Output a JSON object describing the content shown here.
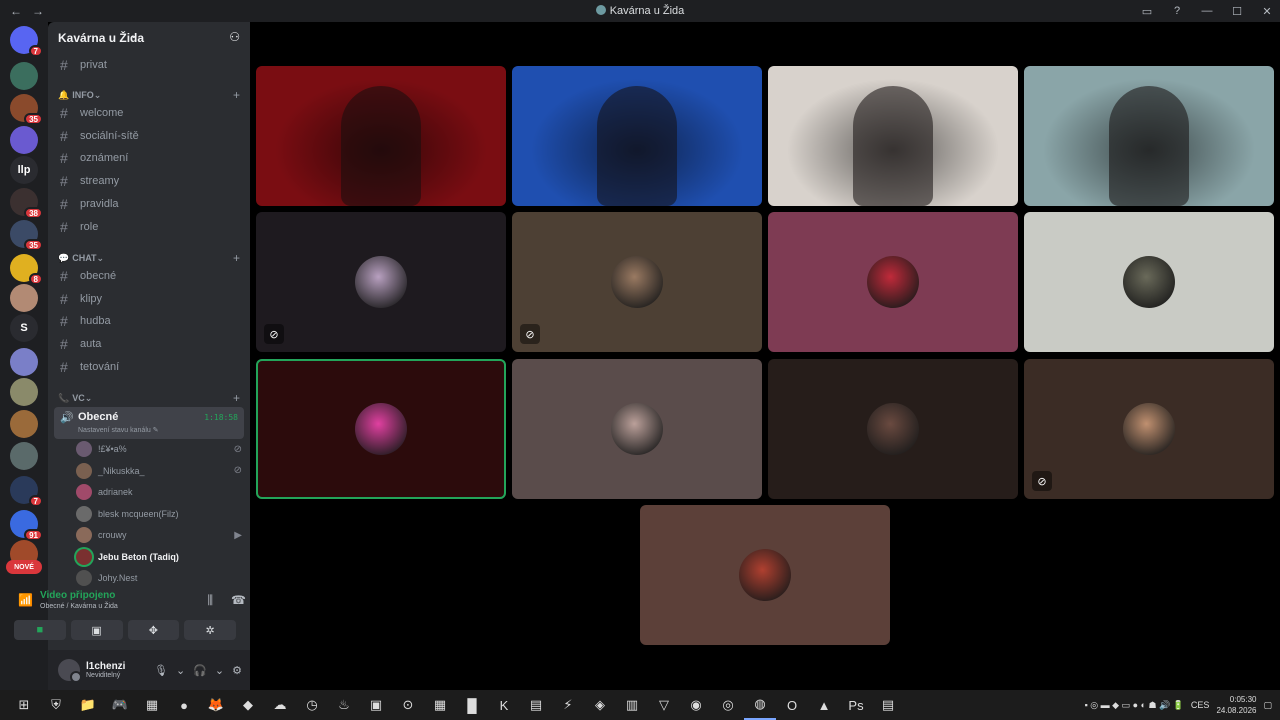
{
  "window": {
    "title": "Kavárna u Žida",
    "nav_back": "←",
    "nav_forward": "→",
    "controls": [
      "inbox-icon",
      "help-icon",
      "minimize",
      "maximize",
      "close"
    ]
  },
  "server_rail": {
    "servers": [
      {
        "label": "",
        "badge": "7",
        "color": "#5865f2",
        "icon": "discord-icon"
      },
      {
        "label": "",
        "badge": "",
        "color": "#3b6e5e"
      },
      {
        "label": "",
        "badge": "35",
        "color": "#8a4a2c"
      },
      {
        "label": "",
        "badge": "",
        "color": "#6a5ad0"
      },
      {
        "label": "llp",
        "badge": "",
        "color": "#2a2b30"
      },
      {
        "label": "",
        "badge": "38",
        "color": "#3b3030"
      },
      {
        "label": "",
        "badge": "35",
        "color": "#3b4a66"
      },
      {
        "label": "",
        "badge": "8",
        "color": "#e0b020"
      },
      {
        "label": "",
        "badge": "",
        "color": "#b28a74"
      },
      {
        "label": "S",
        "badge": "",
        "color": "#2a2b30"
      },
      {
        "label": "",
        "badge": "",
        "color": "#7a7fc8"
      },
      {
        "label": "",
        "badge": "",
        "color": "#8a8a6a"
      },
      {
        "label": "",
        "badge": "",
        "color": "#9a6a3a"
      },
      {
        "label": "",
        "badge": "",
        "color": "#5a6a6a"
      },
      {
        "label": "",
        "badge": "7",
        "color": "#2a3a5a"
      },
      {
        "label": "",
        "badge": "91",
        "color": "#3a6ae0"
      },
      {
        "label": "",
        "badge": "",
        "color": "#a04a2a"
      }
    ],
    "new_label": "NOVÉ"
  },
  "guild": {
    "name": "Kavárna u Žida",
    "top_channel": "privat",
    "categories": [
      {
        "name": "INFO",
        "emoji": "🔔",
        "channels": [
          "welcome",
          "sociální-sítě",
          "oznámení",
          "streamy",
          "pravidla",
          "role"
        ]
      },
      {
        "name": "CHAT",
        "emoji": "💬",
        "channels": [
          "obecné",
          "klipy",
          "hudba",
          "auta",
          "tetování"
        ]
      },
      {
        "name": "VC",
        "emoji": "📞",
        "channels": []
      }
    ],
    "active_voice": {
      "name": "Obecné",
      "timer": "1:18:58",
      "status": "Nastavení stavu kanálu"
    },
    "members": [
      {
        "name": "!£¥•a%",
        "trail": "⊘",
        "speaking": false,
        "color": "#6a5a70"
      },
      {
        "name": "_Nikuskka_",
        "trail": "⊘",
        "speaking": false,
        "color": "#7a6050"
      },
      {
        "name": "adrianek",
        "trail": "",
        "speaking": false,
        "color": "#a04a6a"
      },
      {
        "name": "blesk mcqueen(Filz)",
        "trail": "",
        "speaking": false,
        "color": "#6a6a6a"
      },
      {
        "name": "crouwy",
        "trail": "▶",
        "speaking": false,
        "color": "#8a6a5a"
      },
      {
        "name": "Jebu Beton (Tadiq)",
        "trail": "",
        "speaking": true,
        "color": "#7a3030"
      },
      {
        "name": "Johy.Nest",
        "trail": "",
        "speaking": false,
        "color": "#505050"
      }
    ]
  },
  "voice_panel": {
    "status": "Video připojeno",
    "location": "Obecné / Kavárna u Žida",
    "buttons": [
      "camera-icon",
      "screen-share-icon",
      "activities-icon",
      "soundboard-icon"
    ]
  },
  "user": {
    "name": "l1chenzi",
    "status": "Neviditelný"
  },
  "video_tiles": [
    {
      "kind": "camera",
      "bg": "#7a0d12",
      "muted": false,
      "speaking": false
    },
    {
      "kind": "camera",
      "bg": "#1f4fb0",
      "muted": false,
      "speaking": false
    },
    {
      "kind": "camera",
      "bg": "#d8d2cc",
      "muted": false,
      "speaking": false
    },
    {
      "kind": "camera",
      "bg": "#8aa5a8",
      "muted": false,
      "speaking": false
    },
    {
      "kind": "avatar",
      "bg": "#1e1a1f",
      "av": "#b8a0c0",
      "muted": true,
      "speaking": false
    },
    {
      "kind": "avatar",
      "bg": "#4d4034",
      "av": "#9a7a62",
      "muted": true,
      "speaking": false
    },
    {
      "kind": "avatar",
      "bg": "#7e3b53",
      "av": "#c02a3a",
      "muted": false,
      "speaking": false
    },
    {
      "kind": "avatar",
      "bg": "#c9cbc5",
      "av": "#6a6a5a",
      "muted": false,
      "speaking": false
    },
    {
      "kind": "avatar",
      "bg": "#2c0b0c",
      "av": "#e040a0",
      "muted": false,
      "speaking": true
    },
    {
      "kind": "avatar",
      "bg": "#5a4c4b",
      "av": "#bba09a",
      "muted": false,
      "speaking": false
    },
    {
      "kind": "avatar",
      "bg": "#261d1a",
      "av": "#6a4a40",
      "muted": false,
      "speaking": false
    },
    {
      "kind": "avatar",
      "bg": "#3b2c25",
      "av": "#c09070",
      "muted": true,
      "speaking": false
    },
    {
      "kind": "avatar",
      "bg": "#5c4039",
      "av": "#b04030",
      "muted": false,
      "speaking": false
    }
  ],
  "taskbar": {
    "apps": [
      "⊞",
      "⛨",
      "📁",
      "🎮",
      "▦",
      "●",
      "🦊",
      "◆",
      "☁",
      "◷",
      "♨",
      "▣",
      "⊙",
      "▦",
      "█",
      "K",
      "▤",
      "⚡",
      "◈",
      "▥",
      "▽",
      "◉",
      "◎",
      "◍",
      "O",
      "▲",
      "Ps",
      "▤"
    ],
    "tray_lang": "CES",
    "time": "0:05:30",
    "date": "24.08.2026"
  }
}
